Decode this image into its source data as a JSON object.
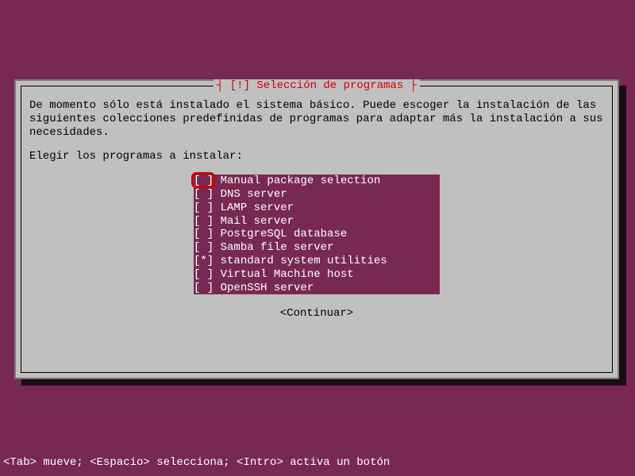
{
  "dialog": {
    "title": "[!] Selección de programas",
    "intro": "De momento sólo está instalado el sistema básico. Puede escoger la instalación de las siguientes colecciones predefinidas de programas para adaptar más la instalación a sus necesidades.",
    "prompt": "Elegir los programas a instalar:",
    "continue": "<Continuar>"
  },
  "packages": [
    {
      "checked": false,
      "label": "Manual package selection",
      "highlighted": true
    },
    {
      "checked": false,
      "label": "DNS server",
      "highlighted": false
    },
    {
      "checked": false,
      "label": "LAMP server",
      "highlighted": false
    },
    {
      "checked": false,
      "label": "Mail server",
      "highlighted": false
    },
    {
      "checked": false,
      "label": "PostgreSQL database",
      "highlighted": false
    },
    {
      "checked": false,
      "label": "Samba file server",
      "highlighted": false
    },
    {
      "checked": true,
      "label": "standard system utilities",
      "highlighted": false
    },
    {
      "checked": false,
      "label": "Virtual Machine host",
      "highlighted": false
    },
    {
      "checked": false,
      "label": "OpenSSH server",
      "highlighted": false
    }
  ],
  "footer": "<Tab> mueve; <Espacio> selecciona; <Intro> activa un botón"
}
